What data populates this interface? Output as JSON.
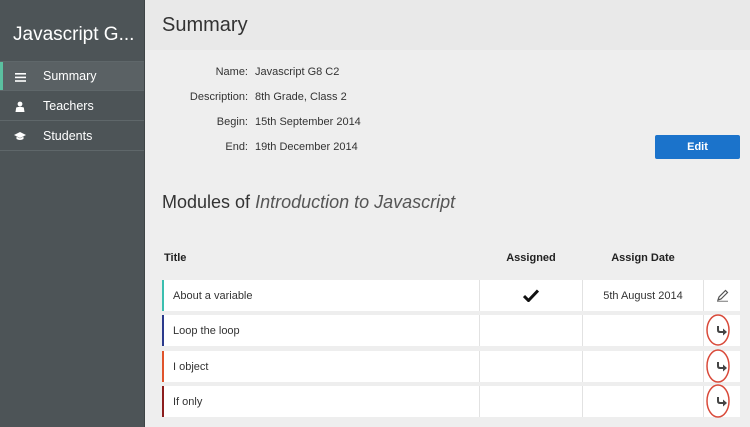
{
  "sidebar": {
    "app_title": "Javascript G...",
    "nav": [
      {
        "label": "Summary",
        "icon": "list-icon",
        "active": true
      },
      {
        "label": "Teachers",
        "icon": "teacher-icon",
        "active": false
      },
      {
        "label": "Students",
        "icon": "graduation-cap-icon",
        "active": false
      }
    ]
  },
  "summary": {
    "title": "Summary",
    "fields": [
      {
        "label": "Name:",
        "value": "Javascript G8 C2"
      },
      {
        "label": "Description:",
        "value": "8th Grade, Class 2"
      },
      {
        "label": "Begin:",
        "value": "15th September 2014"
      },
      {
        "label": "End:",
        "value": "19th December 2014"
      }
    ],
    "edit_label": "Edit"
  },
  "modules": {
    "heading_prefix": "Modules of",
    "course_name": "Introduction to Javascript",
    "columns": {
      "title": "Title",
      "assigned": "Assigned",
      "assign_date": "Assign Date"
    },
    "rows": [
      {
        "title": "About a variable",
        "assigned": true,
        "assign_date": "5th August 2014",
        "action_icon": "pencil-icon",
        "stripe_color": "#3bbfb0"
      },
      {
        "title": "Loop the loop",
        "assigned": false,
        "assign_date": "",
        "action_icon": "arrow-down-right-icon",
        "stripe_color": "#2b3a8c"
      },
      {
        "title": "I object",
        "assigned": false,
        "assign_date": "",
        "action_icon": "arrow-down-right-icon",
        "stripe_color": "#e0532b"
      },
      {
        "title": "If only",
        "assigned": false,
        "assign_date": "",
        "action_icon": "arrow-down-right-icon",
        "stripe_color": "#8c1d1d"
      }
    ]
  },
  "colors": {
    "accent": "#1b73cb",
    "sidebar_bg": "#4d5457",
    "annotation": "#d94a3a"
  }
}
